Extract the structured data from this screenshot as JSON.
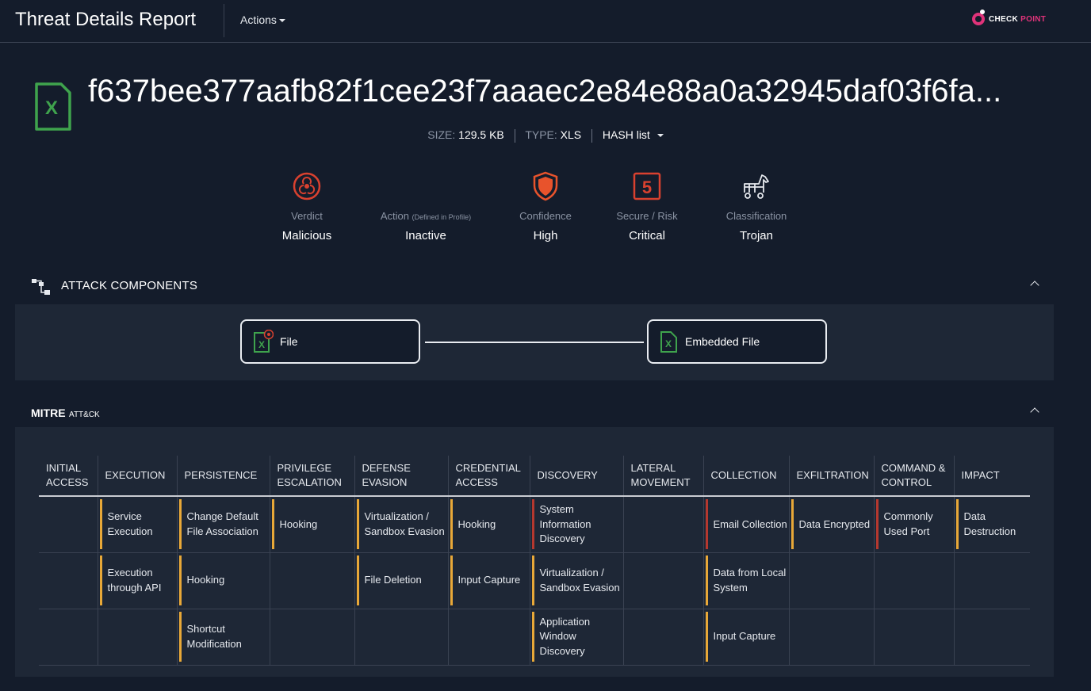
{
  "header": {
    "title": "Threat Details Report",
    "actions_label": "Actions",
    "brand": {
      "part1": "CHECK",
      "part2": "POINT"
    }
  },
  "file": {
    "hash": "f637bee377aafb82f1cee23f7aaaec2e84e88a0a32945daf03f6fa...",
    "icon_letter": "X",
    "size_label": "SIZE:",
    "size_value": "129.5 KB",
    "type_label": "TYPE:",
    "type_value": "XLS",
    "hash_list_label": "HASH list"
  },
  "stats": [
    {
      "label": "Verdict",
      "value": "Malicious",
      "icon": "biohazard-icon",
      "color": "#d9412f"
    },
    {
      "label": "Action",
      "label_note": "(Defined in Profile)",
      "value": "Inactive",
      "icon": "none"
    },
    {
      "label": "Confidence",
      "value": "High",
      "icon": "shield-icon",
      "color": "#e8532c"
    },
    {
      "label": "Secure / Risk",
      "value": "Critical",
      "icon": "risk-score-icon",
      "score": "5",
      "color": "#d9412f"
    },
    {
      "label": "Classification",
      "value": "Trojan",
      "icon": "trojan-horse-icon"
    }
  ],
  "attack_components": {
    "title": "ATTACK COMPONENTS",
    "nodes": [
      {
        "label": "File"
      },
      {
        "label": "Embedded File"
      }
    ]
  },
  "mitre": {
    "title": "MITRE",
    "subtitle": "ATT&CK",
    "columns": [
      "INITIAL ACCESS",
      "EXECUTION",
      "PERSISTENCE",
      "PRIVILEGE ESCALATION",
      "DEFENSE EVASION",
      "CREDENTIAL ACCESS",
      "DISCOVERY",
      "LATERAL MOVEMENT",
      "COLLECTION",
      "EXFILTRATION",
      "COMMAND & CONTROL",
      "IMPACT"
    ],
    "rows": [
      [
        "",
        "Service Execution",
        "Change Default File Association",
        "Hooking",
        "Virtualization / Sandbox Evasion",
        "Hooking",
        "System Information Discovery",
        "",
        "Email Collection",
        "Data Encrypted",
        "Commonly Used Port",
        "Data Destruction"
      ],
      [
        "",
        "Execution through API",
        "Hooking",
        "",
        "File Deletion",
        "Input Capture",
        "Virtualization / Sandbox Evasion",
        "",
        "Data from Local System",
        "",
        "",
        ""
      ],
      [
        "",
        "",
        "Shortcut Modification",
        "",
        "",
        "",
        "Application Window Discovery",
        "",
        "Input Capture",
        "",
        "",
        ""
      ]
    ],
    "severity": [
      [
        "",
        "medium",
        "medium",
        "medium",
        "medium",
        "medium",
        "high",
        "",
        "high",
        "medium",
        "high",
        "medium"
      ],
      [
        "",
        "medium",
        "medium",
        "",
        "medium",
        "medium",
        "medium",
        "",
        "medium",
        "",
        "",
        ""
      ],
      [
        "",
        "",
        "medium",
        "",
        "",
        "",
        "medium",
        "",
        "medium",
        "",
        "",
        ""
      ]
    ],
    "severity_colors": {
      "medium": "#e8a838",
      "high": "#b5382f"
    }
  }
}
